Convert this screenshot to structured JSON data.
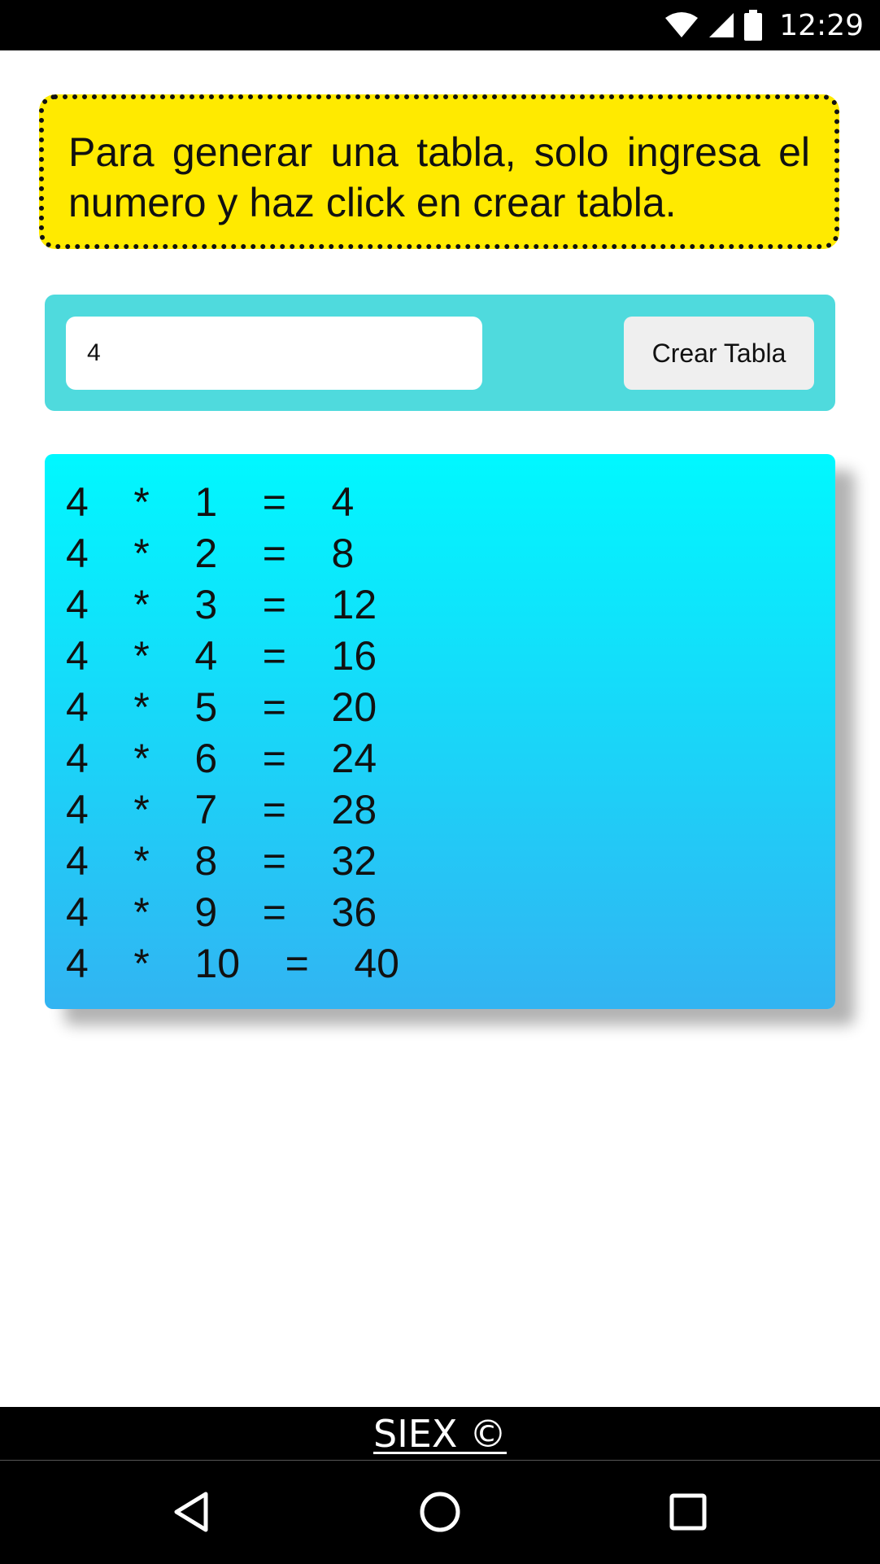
{
  "status_bar": {
    "time": "12:29",
    "icons": [
      "wifi-icon",
      "cellular-signal-icon",
      "battery-icon"
    ]
  },
  "info": {
    "text": "Para generar una tabla, solo ingresa el numero y haz click en crear tabla."
  },
  "form": {
    "input_value": "4",
    "button_label": "Crear Tabla"
  },
  "table": {
    "rows": [
      {
        "text": "4    *    1    =    4"
      },
      {
        "text": "4    *    2    =    8"
      },
      {
        "text": "4    *    3    =    12"
      },
      {
        "text": "4    *    4    =    16"
      },
      {
        "text": "4    *    5    =    20"
      },
      {
        "text": "4    *    6    =    24"
      },
      {
        "text": "4    *    7    =    28"
      },
      {
        "text": "4    *    8    =    32"
      },
      {
        "text": "4    *    9    =    36"
      },
      {
        "text": "4    *    10    =    40"
      }
    ]
  },
  "footer": {
    "label": "SIEX ©"
  },
  "nav": {
    "icons": [
      "back-icon",
      "home-icon",
      "recents-icon"
    ]
  },
  "colors": {
    "info_background": "#ffea00",
    "form_background": "#4fdadd",
    "table_gradient_top": "#00f8ff",
    "table_gradient_bottom": "#32b4f2"
  }
}
